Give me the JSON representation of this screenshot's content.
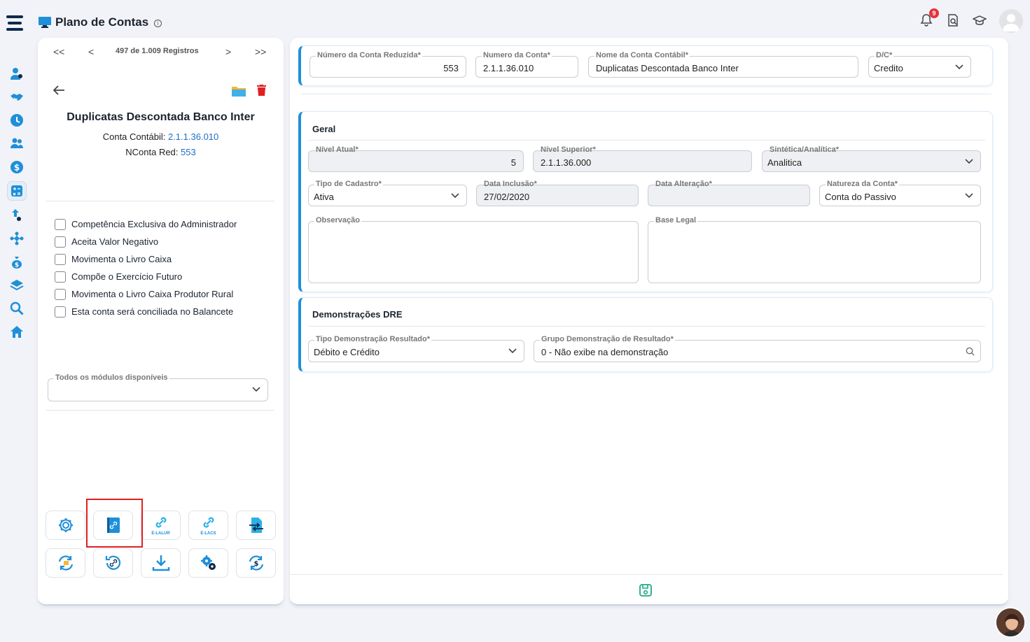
{
  "header": {
    "title": "Plano de Contas",
    "info_symbol": "i",
    "notification_count": "9"
  },
  "pager": {
    "first": "<<",
    "prev": "<",
    "count_label": "497 de 1.009 Registros",
    "next": ">",
    "last": ">>"
  },
  "account": {
    "name": "Duplicatas Descontada Banco Inter",
    "conta_contabil_label": "Conta Contábil:",
    "conta_contabil_value": "2.1.1.36.010",
    "nconta_red_label": "NConta Red:",
    "nconta_red_value": "553"
  },
  "checklist": [
    "Competência Exclusiva do Administrador",
    "Aceita Valor Negativo",
    "Movimenta o Livro Caixa",
    "Compõe o Exercício Futuro",
    "Movimenta o Livro Caixa Produtor Rural",
    "Esta conta será conciliada no Balancete"
  ],
  "modules_field": {
    "label": "Todos os módulos disponíveis",
    "value": ""
  },
  "tools": {
    "elalur_label": "E-LALUR",
    "elacs_label": "E-LACS"
  },
  "top_fields": {
    "numero_reduzida_label": "Número da Conta Reduzida*",
    "numero_reduzida_value": "553",
    "numero_conta_label": "Numero da Conta*",
    "numero_conta_value": "2.1.1.36.010",
    "nome_conta_label": "Nome da Conta Contábil*",
    "nome_conta_value": "Duplicatas Descontada Banco Inter",
    "dc_label": "D/C*",
    "dc_value": "Credito"
  },
  "geral": {
    "title": "Geral",
    "nivel_atual_label": "Nível Atual*",
    "nivel_atual_value": "5",
    "nivel_superior_label": "Nível Superior*",
    "nivel_superior_value": "2.1.1.36.000",
    "sintetica_label": "Sintética/Analítica*",
    "sintetica_value": "Analitica",
    "tipo_cadastro_label": "Tipo de Cadastro*",
    "tipo_cadastro_value": "Ativa",
    "data_inclusao_label": "Data Inclusão*",
    "data_inclusao_value": "27/02/2020",
    "data_alteracao_label": "Data Alteração*",
    "data_alteracao_value": "",
    "natureza_label": "Natureza da Conta*",
    "natureza_value": "Conta do Passivo",
    "observacao_label": "Observação",
    "base_legal_label": "Base Legal"
  },
  "dre": {
    "title": "Demonstrações DRE",
    "tipo_label": "Tipo Demonstração Resultado*",
    "tipo_value": "Débito e Crédito",
    "grupo_label": "Grupo Demonstração de Resultado*",
    "grupo_value": "0 - Não exibe na demonstração"
  },
  "colors": {
    "accent": "#1f8fd8",
    "link": "#1f6fc5",
    "danger": "#e02020",
    "save": "#22a88a"
  }
}
